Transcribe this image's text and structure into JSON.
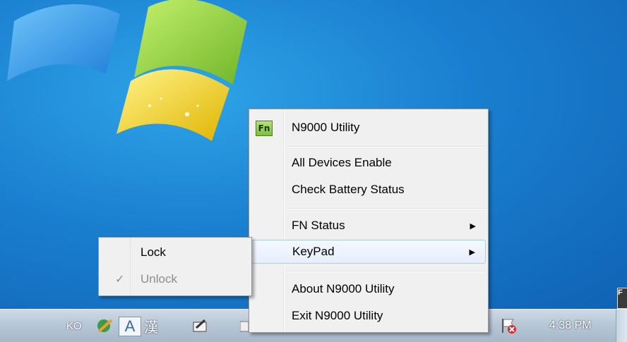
{
  "taskbar": {
    "language": "KO",
    "ime_mode": "A",
    "ime_hanja": "漢",
    "clock": "4:38 PM"
  },
  "menu": {
    "items": [
      {
        "label": "N9000 Utility",
        "icon": "fn-icon",
        "icon_text": "Fn"
      },
      {
        "label": "All Devices Enable"
      },
      {
        "label": "Check Battery Status"
      },
      {
        "label": "FN Status",
        "submenu": true
      },
      {
        "label": "KeyPad",
        "submenu": true,
        "highlighted": true
      },
      {
        "label": "About N9000 Utility"
      },
      {
        "label": "Exit N9000 Utility"
      }
    ],
    "arrow_glyph": "▶"
  },
  "submenu": {
    "items": [
      {
        "label": "Lock"
      },
      {
        "label": "Unlock",
        "checked": true,
        "disabled": true
      }
    ],
    "check_glyph": "✓"
  },
  "colors": {
    "desktop_blue": "#1a7fd0",
    "menu_bg": "#f0f0f0",
    "highlight_border": "#aeccf0",
    "fn_icon_green": "#7fbf3a"
  }
}
